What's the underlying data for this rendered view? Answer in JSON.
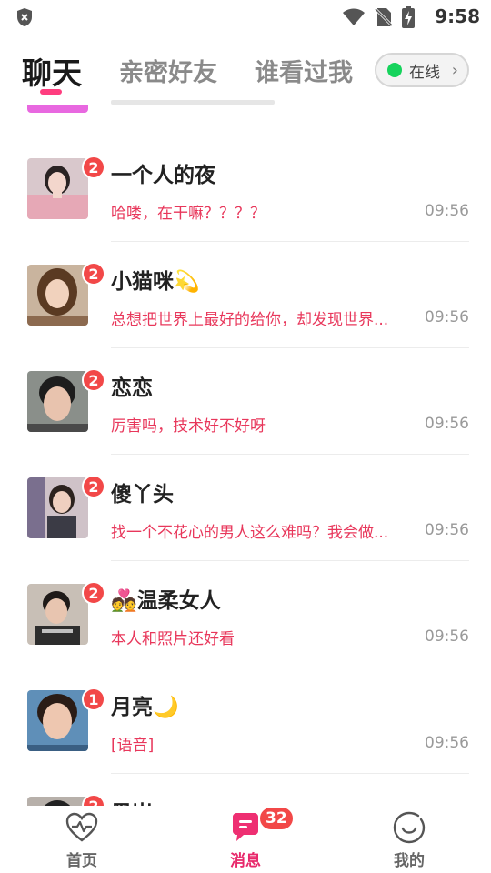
{
  "status_bar": {
    "time": "9:58",
    "icons": [
      "shield-icon",
      "wifi-icon",
      "no-sim-icon",
      "battery-charging-icon"
    ]
  },
  "tabs": [
    {
      "label": "聊天",
      "active": true
    },
    {
      "label": "亲密好友",
      "active": false
    },
    {
      "label": "谁看过我",
      "active": false
    }
  ],
  "online_status": {
    "label": "在线",
    "color": "#16d35c"
  },
  "conversations": [
    {
      "name": "一个人的夜",
      "preview": "哈喽，在干嘛？？？？",
      "time": "09:56",
      "unread": "2"
    },
    {
      "name": "小猫咪💫",
      "preview": "总想把世界上最好的给你，却发现世界...",
      "time": "09:56",
      "unread": "2"
    },
    {
      "name": "恋恋",
      "preview": "厉害吗，技术好不好呀",
      "time": "09:56",
      "unread": "2"
    },
    {
      "name": "傻丫头",
      "preview": "找一个不花心的男人这么难吗？我会做...",
      "time": "09:56",
      "unread": "2"
    },
    {
      "name": "💑温柔女人",
      "preview": "本人和照片还好看",
      "time": "09:56",
      "unread": "2"
    },
    {
      "name": "月亮🌙",
      "preview": "[语音]",
      "time": "09:56",
      "unread": "1"
    },
    {
      "name": "黑岩",
      "preview": "",
      "time": "",
      "unread": "2"
    }
  ],
  "bottom_nav": [
    {
      "label": "首页",
      "icon": "heartbeat-icon",
      "active": false
    },
    {
      "label": "消息",
      "icon": "chat-bubble-icon",
      "active": true,
      "badge": "32"
    },
    {
      "label": "我的",
      "icon": "smiley-face-icon",
      "active": false
    }
  ],
  "colors": {
    "accent": "#e8286b",
    "preview_text": "#e8375b",
    "badge": "#f24848"
  }
}
